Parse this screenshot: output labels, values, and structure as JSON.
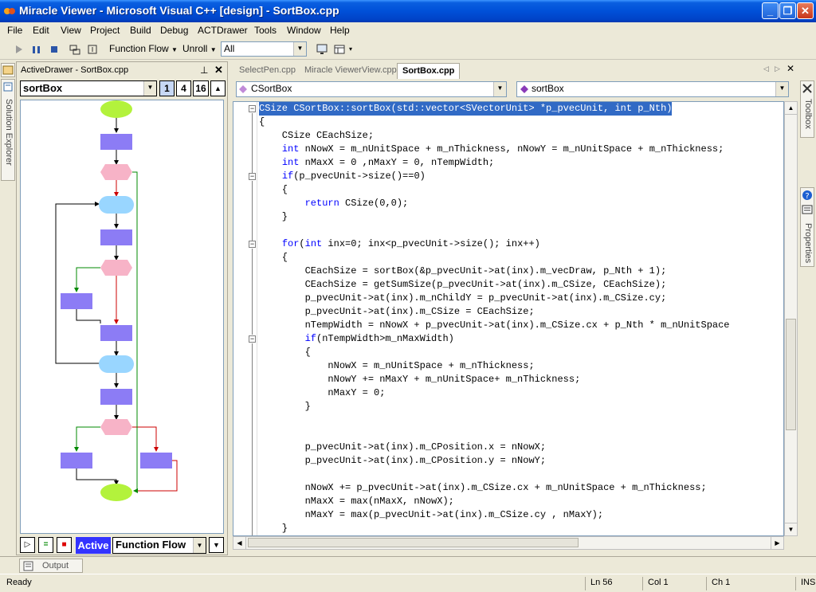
{
  "window": {
    "title": "Miracle Viewer - Microsoft Visual C++ [design] - SortBox.cpp",
    "min": "_",
    "max": "❐",
    "close": "✕"
  },
  "menu": [
    "File",
    "Edit",
    "View",
    "Project",
    "Build",
    "Debug",
    "ACTDrawer",
    "Tools",
    "Window",
    "Help"
  ],
  "toolbar": {
    "flow_dropdown": "Function Flow",
    "unroll_dropdown": "Unroll",
    "filter_value": "All"
  },
  "left_tabs": {
    "solution_explorer": "Solution Explorer"
  },
  "drawer": {
    "title": "ActiveDrawer - SortBox.cpp",
    "function_select": "sortBox",
    "level_buttons": [
      "1",
      "4",
      "16"
    ],
    "active_label": "Active",
    "mode_select": "Function Flow"
  },
  "editor": {
    "tabs": [
      "SelectPen.cpp",
      "Miracle ViewerView.cpp",
      "SortBox.cpp"
    ],
    "active_tab": "SortBox.cpp",
    "class_select": "CSortBox",
    "member_select": "sortBox",
    "lines": [
      "CSize CSortBox::sortBox(std::vector<SVectorUnit> *p_pvecUnit, int p_Nth)",
      "{",
      "    CSize CEachSize;",
      "    int nNowX = m_nUnitSpace + m_nThickness, nNowY = m_nUnitSpace + m_nThickness;",
      "    int nMaxX = 0 ,nMaxY = 0, nTempWidth;",
      "    if(p_pvecUnit->size()==0)",
      "    {",
      "        return CSize(0,0);",
      "    }",
      "",
      "    for(int inx=0; inx<p_pvecUnit->size(); inx++)",
      "    {",
      "        CEachSize = sortBox(&p_pvecUnit->at(inx).m_vecDraw, p_Nth + 1);",
      "        CEachSize = getSumSize(p_pvecUnit->at(inx).m_CSize, CEachSize);",
      "        p_pvecUnit->at(inx).m_nChildY = p_pvecUnit->at(inx).m_CSize.cy;",
      "        p_pvecUnit->at(inx).m_CSize = CEachSize;",
      "        nTempWidth = nNowX + p_pvecUnit->at(inx).m_CSize.cx + p_Nth * m_nUnitSpace",
      "        if(nTempWidth>m_nMaxWidth)",
      "        {",
      "            nNowX = m_nUnitSpace + m_nThickness;",
      "            nNowY += nMaxY + m_nUnitSpace+ m_nThickness;",
      "            nMaxY = 0;",
      "        }",
      "",
      "",
      "        p_pvecUnit->at(inx).m_CPosition.x = nNowX;",
      "        p_pvecUnit->at(inx).m_CPosition.y = nNowY;",
      "",
      "        nNowX += p_pvecUnit->at(inx).m_CSize.cx + m_nUnitSpace + m_nThickness;",
      "        nMaxX = max(nMaxX, nNowX);",
      "        nMaxY = max(p_pvecUnit->at(inx).m_CSize.cy , nMaxY);",
      "    }"
    ]
  },
  "right_tabs": {
    "toolbox": "Toolbox",
    "properties": "Properties"
  },
  "output": {
    "tab": "Output"
  },
  "status": {
    "state": "Ready",
    "line": "Ln 56",
    "col": "Col 1",
    "ch": "Ch 1",
    "mode": "INS"
  },
  "colors": {
    "title_bar": "#0050d8",
    "selection": "#316ac5",
    "keyword": "#0000ff",
    "flow_start_end": "#b3f23c",
    "flow_process": "#8c7cf5",
    "flow_decision": "#f7b3c7",
    "flow_loop": "#99d6ff",
    "active_label": "#3333ff"
  }
}
